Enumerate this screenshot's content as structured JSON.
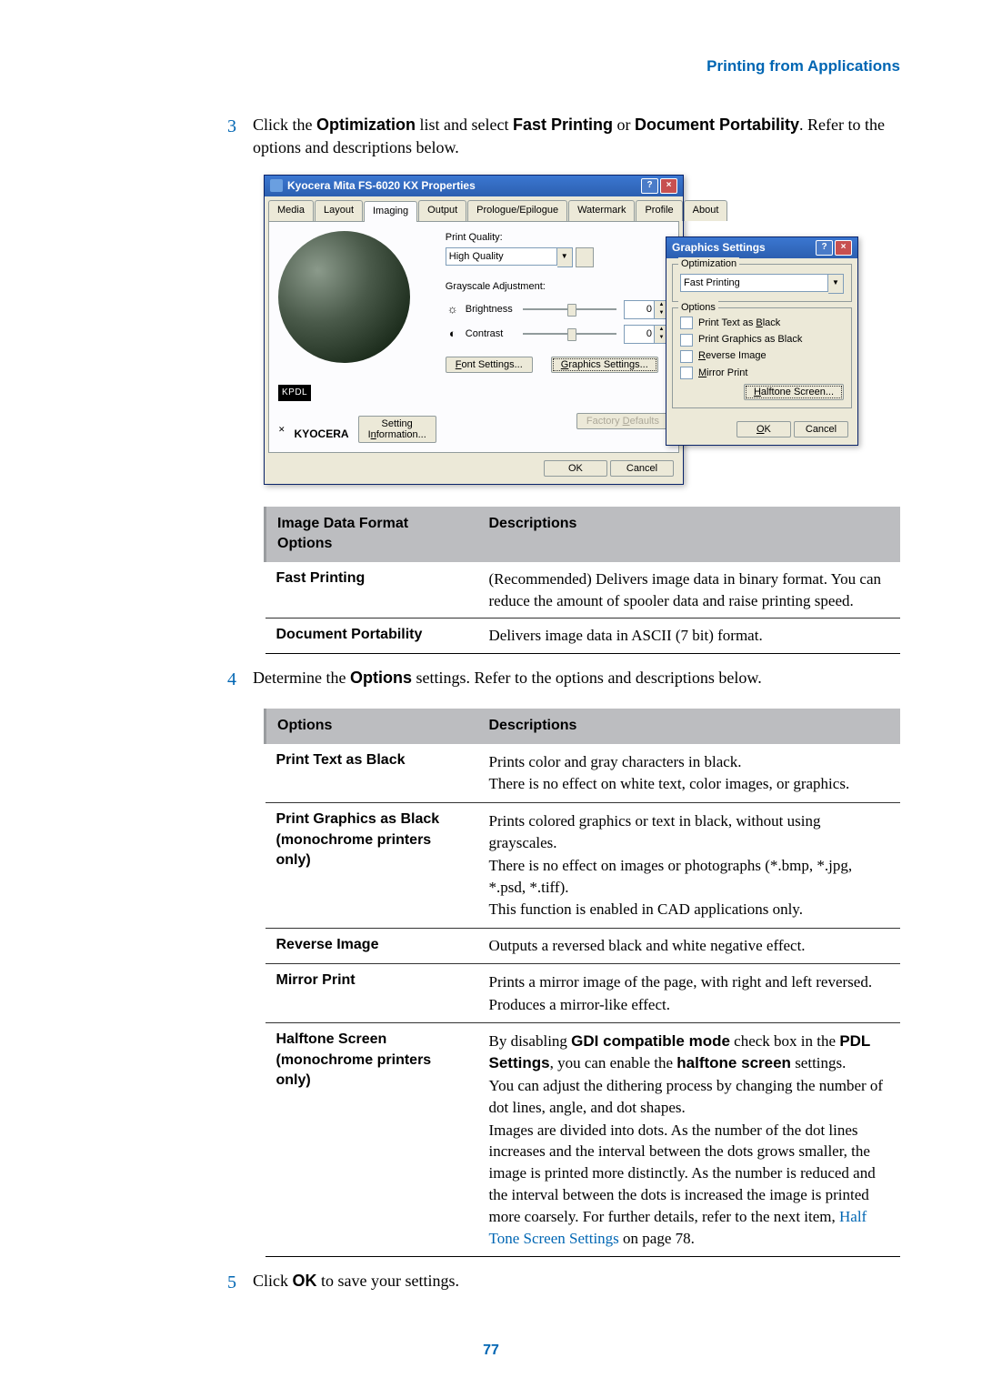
{
  "header": {
    "section": "Printing from Applications"
  },
  "steps": {
    "s3": {
      "num": "3",
      "pre": "Click the ",
      "b1": "Optimization",
      "mid1": " list and select ",
      "b2": "Fast Printing",
      "mid2": " or ",
      "b3": "Document Portability",
      "post": ". Refer to the options and descriptions below."
    },
    "s4": {
      "num": "4",
      "pre": "Determine the ",
      "b1": "Options",
      "post": " settings. Refer to the options and descriptions below."
    },
    "s5": {
      "num": "5",
      "pre": "Click ",
      "b1": "OK",
      "post": " to save your settings."
    }
  },
  "dlg1": {
    "title": "Kyocera Mita FS-6020 KX Properties",
    "tabs": [
      "Media",
      "Layout",
      "Imaging",
      "Output",
      "Prologue/Epilogue",
      "Watermark",
      "Profile",
      "About"
    ],
    "active_tab": "Imaging",
    "print_quality_lbl": "Print Quality:",
    "print_quality_val": "High Quality",
    "grayscale_lbl": "Grayscale Adjustment:",
    "brightness": "Brightness",
    "contrast": "Contrast",
    "val0": "0",
    "font_settings": "Font Settings...",
    "graphics_settings": "Graphics Settings...",
    "kpdl": "KPDL",
    "brand": "KYOCERA",
    "setting_info": "Setting Information...",
    "factory": "Factory Defaults",
    "ok": "OK",
    "cancel": "Cancel"
  },
  "dlg2": {
    "title": "Graphics Settings",
    "opt_legend": "Optimization",
    "opt_val": "Fast Printing",
    "options_legend": "Options",
    "c1": "Print Text as Black",
    "c2": "Print Graphics as Black",
    "c3": "Reverse Image",
    "c4": "Mirror Print",
    "halftone": "Halftone Screen...",
    "ok": "OK",
    "cancel": "Cancel"
  },
  "t1": {
    "h1": "Image Data Format Options",
    "h2": "Descriptions",
    "r1c1": "Fast Printing",
    "r1c2": "(Recommended) Delivers image data in binary format. You can reduce the amount of spooler data and raise printing speed.",
    "r2c1": "Document Portability",
    "r2c2": "Delivers image data in ASCII (7 bit) format."
  },
  "t2": {
    "h1": "Options",
    "h2": "Descriptions",
    "r1c1": "Print Text as Black",
    "r1c2a": "Prints color and gray characters in black.",
    "r1c2b": "There is no effect on white text, color images, or graphics.",
    "r2c1": "Print Graphics as Black (monochrome printers only)",
    "r2c2a": "Prints colored graphics or text in black, without using grayscales.",
    "r2c2b": "There is no effect on images or photographs (*.bmp, *.jpg, *.psd, *.tiff).",
    "r2c2c": "This function is enabled in CAD applications only.",
    "r3c1": "Reverse Image",
    "r3c2": "Outputs a reversed black and white negative effect.",
    "r4c1": "Mirror Print",
    "r4c2a": "Prints a mirror image of the page, with right and left reversed.",
    "r4c2b": "Produces a mirror-like effect.",
    "r5c1": "Halftone Screen (monochrome printers only)",
    "r5c2a": "By disabling ",
    "r5c2b": "GDI compatible mode",
    "r5c2c": " check box in the ",
    "r5c2d": "PDL Settings",
    "r5c2e": ", you can enable the ",
    "r5c2f": "halftone screen",
    "r5c2g": " settings.",
    "r5c2h": "You can adjust the dithering process by changing the number of dot lines, angle, and dot shapes.",
    "r5c2i": "Images are divided into dots. As the number of the dot lines increases and the interval between the dots grows smaller, the image is printed more distinctly. As the number is reduced and the interval between the dots is increased the image is printed more coarsely. For further details, refer to the next item, ",
    "r5c2j": "Half Tone Screen Settings",
    "r5c2k": " on page 78."
  },
  "pagenum": "77"
}
